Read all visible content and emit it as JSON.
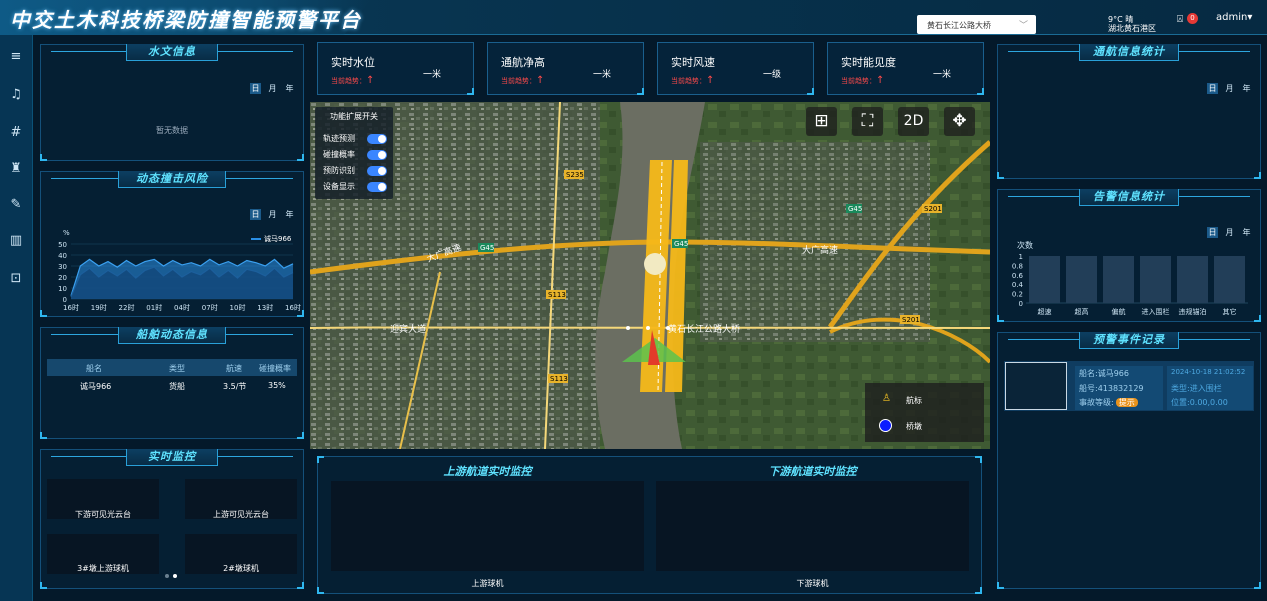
{
  "header": {
    "title": "中交土木科技桥梁防撞智能预警平台",
    "bridge_select": "黄石长江公路大桥",
    "weather_temp": "9°C 晴",
    "weather_location": "湖北黄石港区",
    "notif_count": "0",
    "user": "admin"
  },
  "sidebar": {
    "icons": [
      "menu-icon",
      "bell-icon",
      "settings-sliders-icon",
      "warning-light-icon",
      "wrench-icon",
      "map-icon",
      "monitor-person-icon"
    ]
  },
  "hydro": {
    "title": "水文信息",
    "tabs": [
      "日",
      "月",
      "年"
    ],
    "empty": "暂无数据"
  },
  "risk": {
    "title": "动态撞击风险",
    "tabs": [
      "日",
      "月",
      "年"
    ],
    "unit": "%",
    "legend": "诚马966",
    "yticks": [
      "50",
      "40",
      "30",
      "20",
      "10",
      "0"
    ],
    "xticks": [
      "16时",
      "19时",
      "22时",
      "01时",
      "04时",
      "07时",
      "10时",
      "13时",
      "16时"
    ]
  },
  "chart_data": {
    "type": "area",
    "title": "动态撞击风险",
    "ylabel": "%",
    "ylim": [
      0,
      50
    ],
    "categories": [
      "16时",
      "19时",
      "22时",
      "01时",
      "04时",
      "07时",
      "10时",
      "13时",
      "16时"
    ],
    "series": [
      {
        "name": "诚马966",
        "values": [
          3,
          30,
          36,
          30,
          34,
          29,
          35,
          30,
          34,
          36,
          30,
          35,
          31,
          33,
          30,
          36,
          31,
          34,
          30,
          35,
          33,
          30,
          36,
          28,
          32
        ]
      },
      {
        "values": [
          2,
          22,
          28,
          20,
          26,
          21,
          27,
          19,
          26,
          29,
          21,
          27,
          20,
          25,
          22,
          28,
          20,
          26,
          19,
          27,
          25,
          21,
          28,
          20,
          24
        ]
      }
    ]
  },
  "ships": {
    "title": "船舶动态信息",
    "headers": [
      "船名",
      "类型",
      "航速",
      "碰撞概率"
    ],
    "rows": [
      [
        "诚马966",
        "货船",
        "3.5/节",
        "35%"
      ]
    ]
  },
  "monitor": {
    "title": "实时监控",
    "cams": [
      "下游可见光云台",
      "上游可见光云台",
      "3#墩上游球机",
      "2#墩球机"
    ]
  },
  "metrics": [
    {
      "title": "实时水位",
      "value": "一米",
      "trend": "当前趋势："
    },
    {
      "title": "通航净高",
      "value": "一米",
      "trend": "当前趋势："
    },
    {
      "title": "实时风速",
      "value": "一级",
      "trend": "当前趋势："
    },
    {
      "title": "实时能见度",
      "value": "一米",
      "trend": "当前趋势："
    }
  ],
  "map": {
    "toggle_title": "功能扩展开关",
    "toggles": [
      "轨迹预测",
      "碰撞概率",
      "预防识别",
      "设备显示"
    ],
    "buttons": {
      "layers": "⊞",
      "fullscreen": "⛶",
      "mode": "2D",
      "pan": "✥"
    },
    "labels": {
      "road1": "大广高速",
      "road2": "大广高速",
      "road3": "迎宾大道",
      "road4": "黄石长江公路大桥",
      "sign_g45a": "G45",
      "sign_g45b": "G45",
      "sign_g45c": "G45",
      "sign_s235": "S235",
      "sign_s201a": "S201",
      "sign_s201b": "S201",
      "sign_s113a": "S113",
      "sign_s113b": "S113"
    },
    "legend": [
      {
        "label": "航标"
      },
      {
        "label": "桥墩"
      }
    ]
  },
  "upstream": {
    "title": "上游航道实时监控",
    "label": "上游球机"
  },
  "downstream": {
    "title": "下游航道实时监控",
    "label": "下游球机"
  },
  "navstats": {
    "title": "通航信息统计",
    "tabs": [
      "日",
      "月",
      "年"
    ]
  },
  "alarmstats": {
    "title": "告警信息统计",
    "tabs": [
      "日",
      "月",
      "年"
    ],
    "ylabel": "次数",
    "yticks": [
      "1",
      "0.8",
      "0.6",
      "0.4",
      "0.2",
      "0"
    ],
    "categories": [
      "超速",
      "超高",
      "偏航",
      "进入围栏",
      "违规锚泊",
      "其它"
    ]
  },
  "events": {
    "title": "预警事件记录",
    "ship": "船名:诚马966",
    "mmsi": "船号:413832129",
    "level_label": "事故等级:",
    "level": "提示",
    "time": "2024-10-18 21:02:52",
    "type": "类型:进入围栏",
    "pos": "位置:0.00,0.00"
  }
}
